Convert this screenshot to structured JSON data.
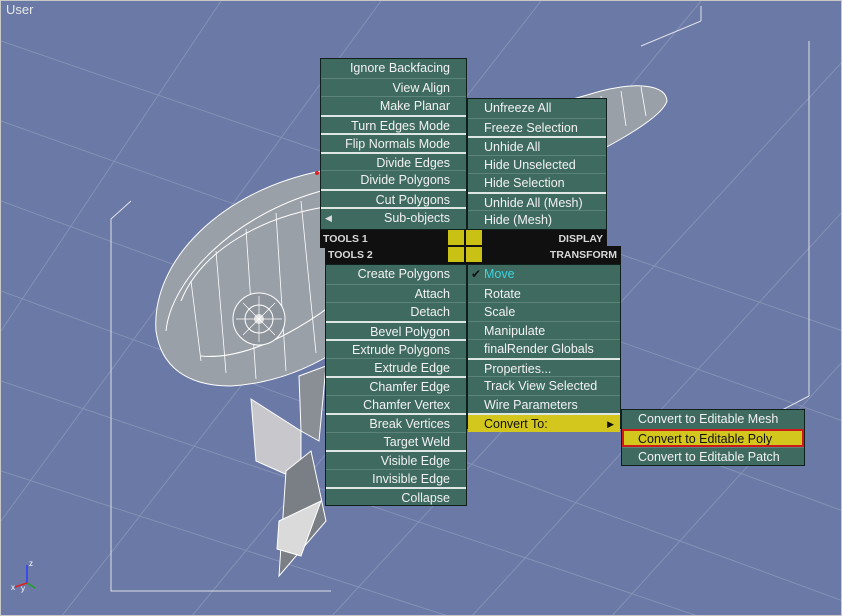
{
  "viewport": {
    "label": "User"
  },
  "quad_top_left": {
    "header": "TOOLS 1",
    "items": [
      {
        "label": "Ignore Backfacing",
        "sep": false
      },
      {
        "label": "View Align",
        "sep": false
      },
      {
        "label": "Make Planar",
        "sep": false
      },
      {
        "label": "Turn Edges Mode",
        "sep": true
      },
      {
        "label": "Flip Normals Mode",
        "sep": true
      },
      {
        "label": "Divide Edges",
        "sep": true
      },
      {
        "label": "Divide Polygons",
        "sep": false
      },
      {
        "label": "Cut Polygons",
        "sep": true
      },
      {
        "label": "Sub-objects",
        "sep": true,
        "arrow": "left"
      }
    ]
  },
  "quad_top_right": {
    "header": "DISPLAY",
    "items": [
      {
        "label": "Unfreeze All"
      },
      {
        "label": "Freeze Selection"
      },
      {
        "label": "Unhide All"
      },
      {
        "label": "Hide Unselected"
      },
      {
        "label": "Hide Selection"
      },
      {
        "label": "Unhide All (Mesh)"
      },
      {
        "label": "Hide (Mesh)"
      }
    ]
  },
  "quad_bottom_left": {
    "header": "TOOLS 2",
    "items": [
      {
        "label": "Create Polygons",
        "sep": false
      },
      {
        "label": "Attach",
        "sep": false
      },
      {
        "label": "Detach",
        "sep": false
      },
      {
        "label": "Bevel Polygon",
        "sep": true
      },
      {
        "label": "Extrude Polygons",
        "sep": true
      },
      {
        "label": "Extrude Edge",
        "sep": false
      },
      {
        "label": "Chamfer Edge",
        "sep": true
      },
      {
        "label": "Chamfer Vertex",
        "sep": false
      },
      {
        "label": "Break Vertices",
        "sep": true
      },
      {
        "label": "Target Weld",
        "sep": false
      },
      {
        "label": "Visible Edge",
        "sep": true
      },
      {
        "label": "Invisible Edge",
        "sep": false
      },
      {
        "label": "Collapse",
        "sep": true
      }
    ]
  },
  "quad_bottom_right": {
    "header": "TRANSFORM",
    "items": [
      {
        "label": "Move",
        "checked": true,
        "active": true
      },
      {
        "label": "Rotate"
      },
      {
        "label": "Scale"
      },
      {
        "label": "Manipulate"
      },
      {
        "label": "finalRender Globals"
      },
      {
        "label": "Properties..."
      },
      {
        "label": "Track View Selected"
      },
      {
        "label": "Wire Parameters"
      },
      {
        "label": "Convert To:",
        "highlighted": true,
        "arrow": "right"
      }
    ]
  },
  "convert_submenu": {
    "items": [
      {
        "label": "Convert to Editable Mesh"
      },
      {
        "label": "Convert to Editable Poly",
        "highlighted": true
      },
      {
        "label": "Convert to Editable Patch"
      }
    ]
  },
  "axis": {
    "x": "x",
    "y": "y",
    "z": "z"
  },
  "colors": {
    "menu_bg": "#3f6a60",
    "highlight": "#d3c71d",
    "viewport_bg": "#6a79a5",
    "active_text": "#3cd4e0"
  }
}
